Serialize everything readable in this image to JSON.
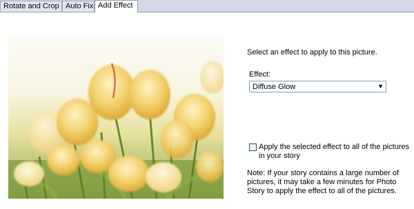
{
  "tabs": [
    {
      "label": "Rotate and Crop"
    },
    {
      "label": "Auto Fix"
    },
    {
      "label": "Add Effect"
    }
  ],
  "active_tab": "Add Effect",
  "instruction": "Select an effect to apply to this picture.",
  "effect": {
    "label": "Effect:",
    "selected": "Diffuse Glow",
    "arrow_icon": "dropdown-arrow-icon"
  },
  "apply_all": {
    "checked": false,
    "line1": "Apply the selected effect to all of the pictures",
    "line2": "in your story"
  },
  "note": {
    "line1": "Note: If your story contains a large number of",
    "line2": "pictures, it may take a few minutes for Photo",
    "line3": "Story to apply the effect to all of the pictures."
  },
  "colors": {
    "tabstrip": "#d4d8e8",
    "tab_border": "#8f98b0",
    "select_border": "#7f9db9",
    "checkbox_border": "#1c5180"
  }
}
